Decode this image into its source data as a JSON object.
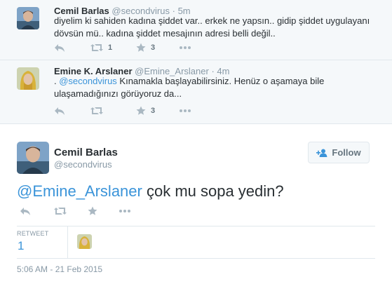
{
  "tweets": [
    {
      "name": "Cemil Barlas",
      "handle": "@secondvirus",
      "sep": "·",
      "time": "5m",
      "text": "diyelim ki sahiden kadına şiddet var.. erkek ne yapsın.. gidip şiddet uygulayanı dövsün mü.. kadına şiddet mesajının adresi belli değil..",
      "retweet_count": "1",
      "favorite_count": "3"
    },
    {
      "name": "Emine K. Arslaner",
      "handle": "@Emine_Arslaner",
      "sep": "·",
      "time": "4m",
      "text_prefix": ". ",
      "mention": "@secondvirus",
      "text_rest": " Kınamakla başlayabilirsiniz. Henüz o aşamaya bile ulaşamadığınızı görüyoruz da...",
      "retweet_count": "",
      "favorite_count": "3"
    }
  ],
  "main": {
    "name": "Cemil Barlas",
    "handle": "@secondvirus",
    "follow_label": "Follow",
    "mention": "@Emine_Arslaner",
    "text_rest": " çok mu sopa yedin?",
    "retweets_label": "RETWEET",
    "retweets_value": "1",
    "timestamp": "5:06 AM - 21 Feb 2015"
  },
  "icons": {
    "reply": "reply-arrow-icon",
    "retweet": "retweet-icon",
    "favorite": "star-icon",
    "more": "more-dots-icon",
    "follow": "add-user-icon"
  },
  "colors": {
    "link": "#3b94d9",
    "muted": "#8899a6",
    "icon": "#aab8c2",
    "background_thread": "#f5f8fa"
  }
}
